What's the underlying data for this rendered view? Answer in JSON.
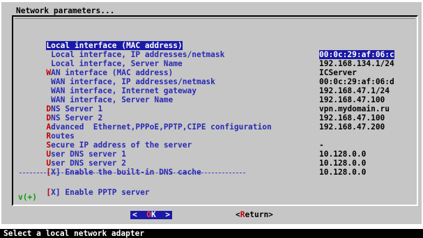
{
  "dialog": {
    "title": "Network parameters..."
  },
  "rows": [
    {
      "hot": "L",
      "label": "ocal interface (MAC address)",
      "value": "00:0c:29:af:06:c"
    },
    {
      "hot": "",
      "label": " Local interface, IP addresses/netmask",
      "value": "192.168.134.1/24"
    },
    {
      "hot": "",
      "label": " Local interface, Server Name",
      "value": "ICServer"
    },
    {
      "hot": "W",
      "label": "AN interface (MAC address)",
      "value": "00:0c:29:af:06:d"
    },
    {
      "hot": "",
      "label": " WAN interface, IP addresses/netmask",
      "value": "192.168.47.1/24"
    },
    {
      "hot": "",
      "label": " WAN interface, Internet gateway",
      "value": "192.168.47.100"
    },
    {
      "hot": "",
      "label": " WAN interface, Server Name",
      "value": "vpn.mydomain.ru"
    },
    {
      "hot": "D",
      "label": "NS Server 1",
      "value": "192.168.47.100"
    },
    {
      "hot": "D",
      "label": "NS Server 2",
      "value": "192.168.47.200"
    },
    {
      "hot": "A",
      "label": "dvanced  Ethernet,PPPoE,PPTP,CIPE configuration",
      "value": ""
    },
    {
      "hot": "R",
      "label": "outes",
      "value": "-"
    },
    {
      "hot": "S",
      "label": "ecure IP address of the server",
      "value": "10.128.0.0"
    },
    {
      "hot": "U",
      "label": "ser DNS server 1",
      "value": "10.128.0.0"
    },
    {
      "hot": "U",
      "label": "ser DNS server 2",
      "value": "10.128.0.0"
    },
    {
      "hot": "[",
      "label": "X] Enable the built-in DNS cache",
      "value": ""
    },
    {
      "hot": "[",
      "label": "X] Enable PPTP server",
      "value": ""
    }
  ],
  "scroll_marker": "v(+)",
  "buttons": {
    "ok_left": "<",
    "ok_hot": "O",
    "ok_rest": "K",
    "ok_right": ">",
    "return_left": "<",
    "return_hot": "R",
    "return_rest": "eturn>"
  },
  "status_bar": "Select a local network adapter",
  "colors": {
    "dialog_bg": "#c6c6c6",
    "selection_bg": "#1a1aa6",
    "label": "#2a2ab4",
    "hotkey": "#c00000",
    "status_bg": "#000000"
  }
}
